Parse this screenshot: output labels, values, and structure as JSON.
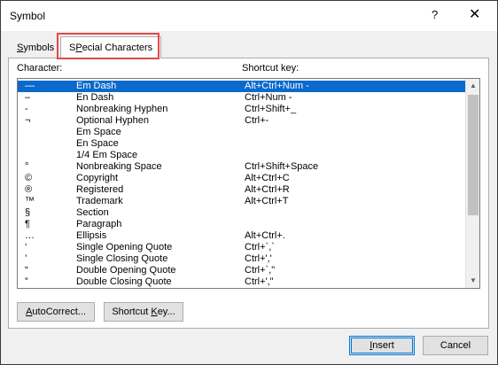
{
  "window": {
    "title": "Symbol",
    "help": "?",
    "close": "✕"
  },
  "tabs": {
    "symbols": {
      "pre": "",
      "u": "S",
      "post": "ymbols"
    },
    "special": {
      "pre": "",
      "u": "P",
      "post": "ecial Characters",
      "lead": "S"
    }
  },
  "columns": {
    "character": "Character:",
    "shortcut": "Shortcut key:"
  },
  "rows": [
    {
      "char": "—",
      "name": "Em Dash",
      "key": "Alt+Ctrl+Num -",
      "selected": true
    },
    {
      "char": "–",
      "name": "En Dash",
      "key": "Ctrl+Num -"
    },
    {
      "char": "‑",
      "name": "Nonbreaking Hyphen",
      "key": "Ctrl+Shift+_"
    },
    {
      "char": "¬",
      "name": "Optional Hyphen",
      "key": "Ctrl+-"
    },
    {
      "char": "",
      "name": "Em Space",
      "key": ""
    },
    {
      "char": "",
      "name": "En Space",
      "key": ""
    },
    {
      "char": "",
      "name": "1/4 Em Space",
      "key": ""
    },
    {
      "char": "°",
      "name": "Nonbreaking Space",
      "key": "Ctrl+Shift+Space"
    },
    {
      "char": "©",
      "name": "Copyright",
      "key": "Alt+Ctrl+C"
    },
    {
      "char": "®",
      "name": "Registered",
      "key": "Alt+Ctrl+R"
    },
    {
      "char": "™",
      "name": "Trademark",
      "key": "Alt+Ctrl+T"
    },
    {
      "char": "§",
      "name": "Section",
      "key": ""
    },
    {
      "char": "¶",
      "name": "Paragraph",
      "key": ""
    },
    {
      "char": "…",
      "name": "Ellipsis",
      "key": "Alt+Ctrl+."
    },
    {
      "char": "‘",
      "name": "Single Opening Quote",
      "key": "Ctrl+`,`"
    },
    {
      "char": "’",
      "name": "Single Closing Quote",
      "key": "Ctrl+','"
    },
    {
      "char": "“",
      "name": "Double Opening Quote",
      "key": "Ctrl+`,\""
    },
    {
      "char": "”",
      "name": "Double Closing Quote",
      "key": "Ctrl+',\""
    }
  ],
  "buttons": {
    "autocorrect": {
      "u": "A",
      "post": "utoCorrect..."
    },
    "shortcut": {
      "pre": "Shortcut ",
      "u": "K",
      "post": "ey..."
    },
    "insert": {
      "u": "I",
      "post": "nsert"
    },
    "cancel": "Cancel"
  },
  "scrollbar": {
    "up_icon": "▲",
    "down_icon": "▼"
  },
  "colors": {
    "selection": "#0a6acc",
    "highlight_box": "#e04a47",
    "default_button_border": "#0078d7"
  }
}
